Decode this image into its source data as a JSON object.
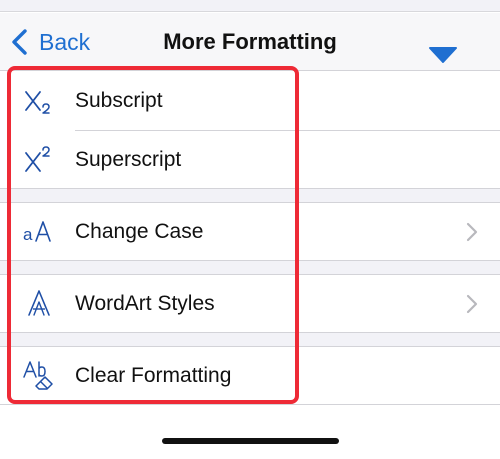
{
  "navbar": {
    "back_label": "Back",
    "title": "More Formatting"
  },
  "items": [
    {
      "label": "Subscript",
      "icon": "subscript-icon",
      "has_chevron": false
    },
    {
      "label": "Superscript",
      "icon": "superscript-icon",
      "has_chevron": false
    },
    {
      "label": "Change Case",
      "icon": "change-case-icon",
      "has_chevron": true
    },
    {
      "label": "WordArt Styles",
      "icon": "wordart-icon",
      "has_chevron": true
    },
    {
      "label": "Clear Formatting",
      "icon": "clear-formatting-icon",
      "has_chevron": false
    }
  ],
  "colors": {
    "accent": "#1f6fd1",
    "icon": "#1f4fa6",
    "highlight": "#ee2a36",
    "group_background": "#f2f2f7"
  }
}
